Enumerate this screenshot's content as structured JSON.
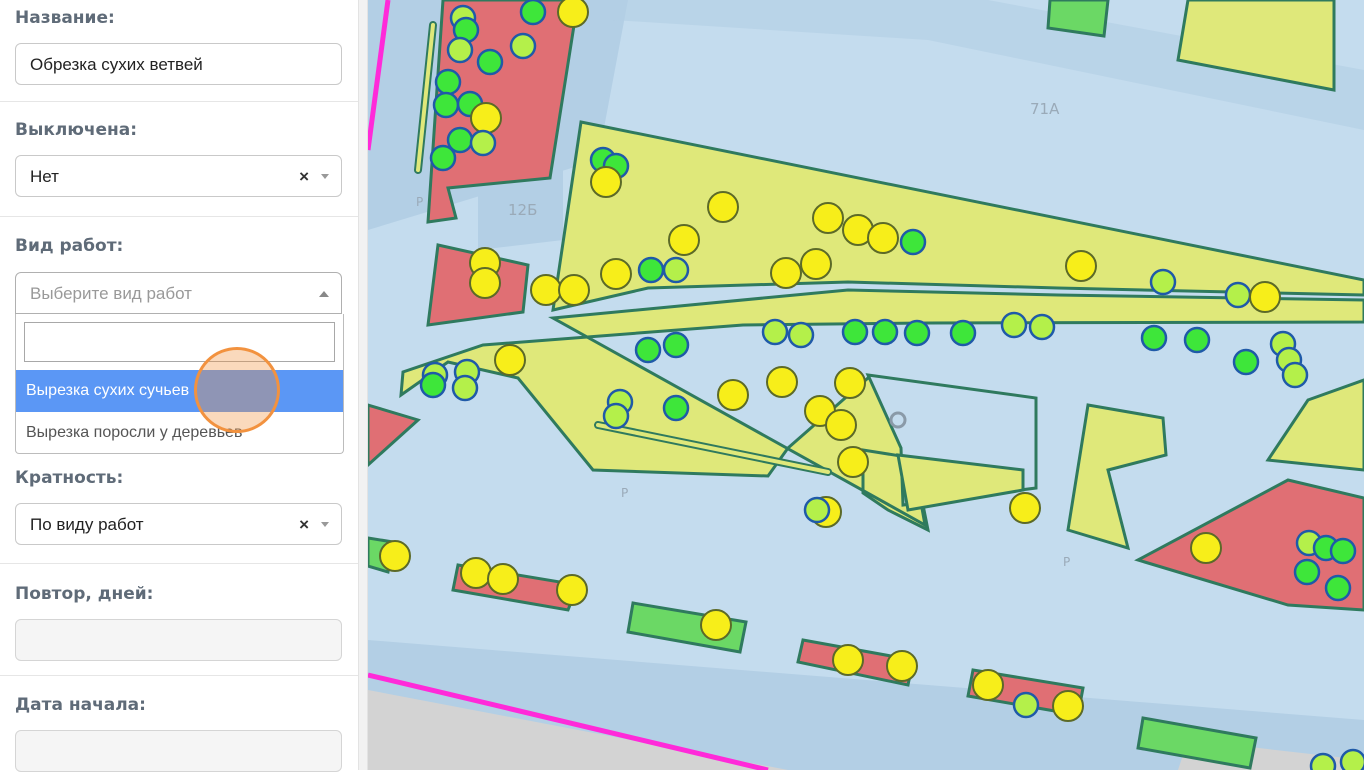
{
  "form": {
    "name": {
      "label": "Название:",
      "value": "Обрезка сухих ветвей"
    },
    "disabled": {
      "label": "Выключена:",
      "value": "Нет",
      "clear": "×"
    },
    "work_type": {
      "label": "Вид работ:",
      "placeholder": "Выберите вид работ",
      "search_value": "",
      "options": [
        "Вырезка сухих сучьев",
        "Вырезка поросли у деревьев"
      ],
      "highlighted_option": "Вырезка сухих сучьев"
    },
    "frequency": {
      "label": "Кратность:",
      "value": "По виду работ",
      "clear": "×"
    },
    "repeat_days": {
      "label": "Повтор, дней:",
      "value": ""
    },
    "start_date": {
      "label": "Дата начала:",
      "value": ""
    }
  },
  "map": {
    "labels": [
      "71А",
      "12Б",
      "Р",
      "Р",
      "Р"
    ],
    "colors": {
      "background": "#c4dcee",
      "road": "#b3cfe5",
      "lawn": "#dfe87a",
      "building_red": "#e06f74",
      "green_patch": "#6bd865",
      "outline": "#2f7a5e",
      "boundary": "#ff2ad9",
      "tree_yellow": "#f7ee1a",
      "tree_green": "#3ee63a",
      "tree_lime": "#b4f04a"
    }
  }
}
